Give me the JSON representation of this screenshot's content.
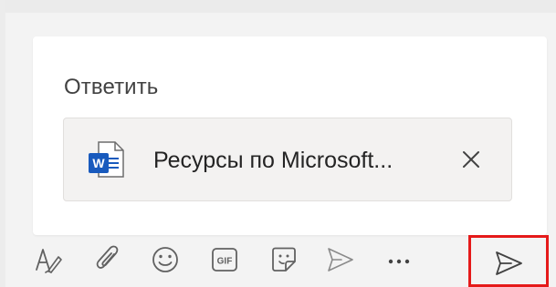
{
  "reply_box": {
    "title": "Ответить"
  },
  "attachment": {
    "file_name": "Ресурсы по Microsoft...",
    "icon": "word-document-icon",
    "icon_letter": "W",
    "remove_icon": "close-icon"
  },
  "toolbar": {
    "items": [
      {
        "name": "format",
        "icon": "format-text-icon"
      },
      {
        "name": "attach",
        "icon": "paperclip-icon"
      },
      {
        "name": "emoji",
        "icon": "emoji-icon"
      },
      {
        "name": "gif",
        "icon": "gif-icon",
        "label": "GIF"
      },
      {
        "name": "sticker",
        "icon": "sticker-icon"
      },
      {
        "name": "loop",
        "icon": "send-loop-icon"
      },
      {
        "name": "more",
        "icon": "more-icon"
      }
    ],
    "send": {
      "icon": "send-icon"
    }
  },
  "colors": {
    "word_blue": "#185abd",
    "highlight_red": "#e51a1a",
    "icon_gray": "#616161"
  }
}
